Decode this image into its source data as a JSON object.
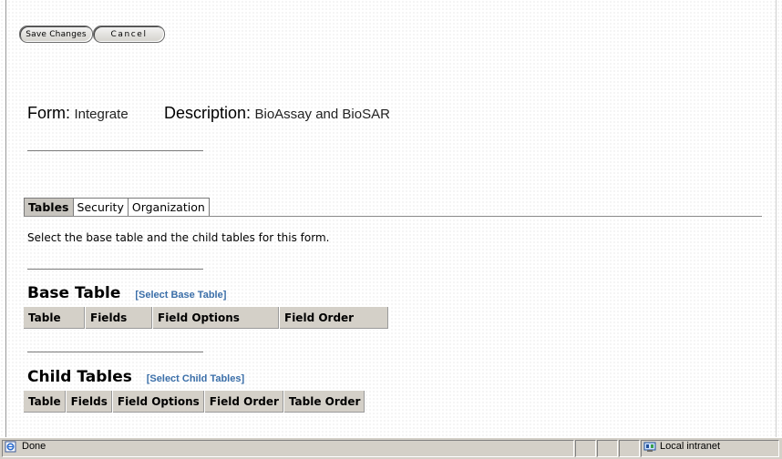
{
  "toolbar": {
    "save_label": "Save Changes",
    "cancel_label": "Cancel"
  },
  "form_header": {
    "form_label": "Form:",
    "form_value": "Integrate",
    "description_label": "Description:",
    "description_value": "BioAssay and BioSAR"
  },
  "tabs": [
    {
      "label": "Tables",
      "active": true
    },
    {
      "label": "Security",
      "active": false
    },
    {
      "label": "Organization",
      "active": false
    }
  ],
  "instructions": "Select the base table and the child tables for this form.",
  "base_table": {
    "title": "Base Table",
    "link": "[Select Base Table]",
    "columns": [
      "Table",
      "Fields",
      "Field Options",
      "Field Order"
    ]
  },
  "child_tables": {
    "title": "Child Tables",
    "link": "[Select Child Tables]",
    "columns": [
      "Table",
      "Fields",
      "Field Options",
      "Field Order",
      "Table Order"
    ]
  },
  "statusbar": {
    "status_text": "Done",
    "zone_text": "Local intranet",
    "icons": [
      "ie-page-icon",
      "intranet-zone-icon"
    ]
  },
  "colors": {
    "header_bg": "#d4d0c8",
    "link": "#3a6ea8",
    "active_tab": "#c8c5bf"
  }
}
